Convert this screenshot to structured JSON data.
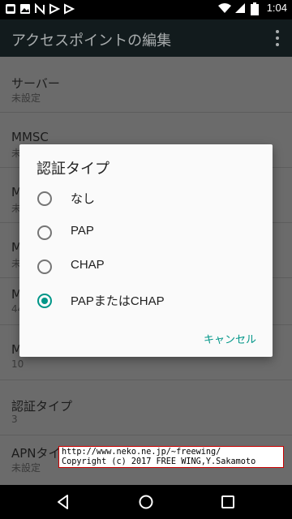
{
  "status_bar": {
    "time": "1:04",
    "left_icons": [
      "notification-icon",
      "image-icon",
      "n-icon",
      "play-icon",
      "play-icon"
    ],
    "right_icons": [
      "wifi-icon",
      "signal-icon",
      "battery-icon"
    ]
  },
  "app_bar": {
    "title": "アクセスポイントの編集",
    "menu_icon": "overflow-menu-icon"
  },
  "list_items": [
    {
      "title": "サーバー",
      "summary": "未設定"
    },
    {
      "title": "MMSC",
      "summary": "未設定"
    },
    {
      "title": "M",
      "summary": "未"
    },
    {
      "title": "M",
      "summary": "未"
    },
    {
      "title": "M",
      "summary": "44"
    },
    {
      "title": "M",
      "summary": "10"
    },
    {
      "title": "認証タイプ",
      "summary": "3"
    },
    {
      "title": "APNタイプ",
      "summary": "未設定"
    }
  ],
  "dialog": {
    "title": "認証タイプ",
    "options": [
      {
        "label": "なし",
        "selected": false
      },
      {
        "label": "PAP",
        "selected": false
      },
      {
        "label": "CHAP",
        "selected": false
      },
      {
        "label": "PAPまたはCHAP",
        "selected": true
      }
    ],
    "cancel_label": "キャンセル"
  },
  "watermark": {
    "line1": "http://www.neko.ne.jp/~freewing/",
    "line2": "Copyright (c) 2017 FREE WING,Y.Sakamoto"
  },
  "nav_bar": {
    "icons": [
      "back-icon",
      "home-icon",
      "recent-apps-icon"
    ]
  },
  "colors": {
    "accent": "#009688",
    "app_bar": "#121b1d",
    "scrim_background": "#6b6b6b"
  }
}
